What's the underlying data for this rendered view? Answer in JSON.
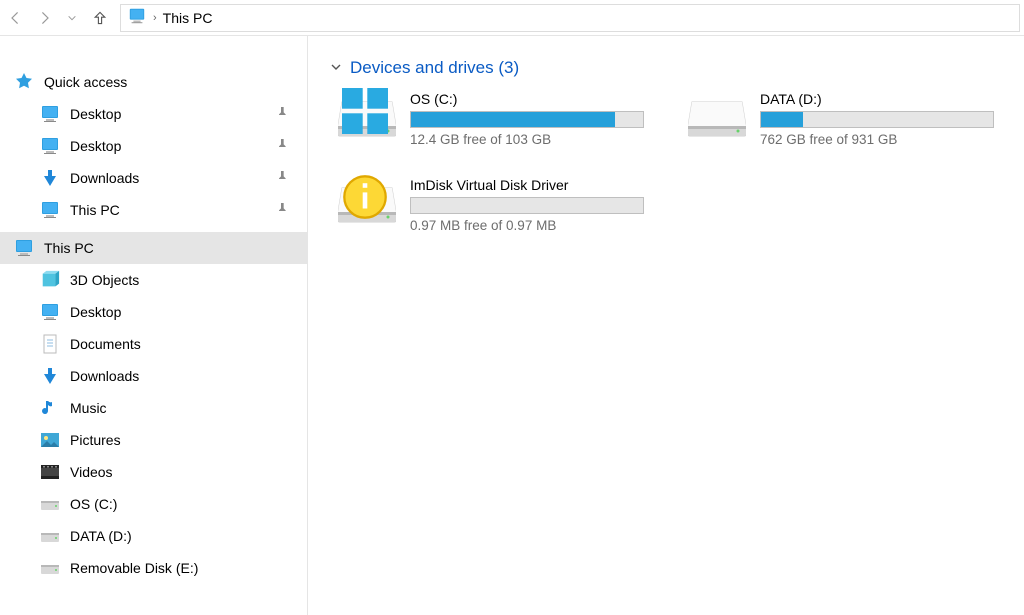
{
  "breadcrumb": {
    "location": "This PC"
  },
  "sidebar": {
    "quick_access": {
      "label": "Quick access",
      "items": [
        {
          "label": "Desktop"
        },
        {
          "label": "Desktop"
        },
        {
          "label": "Downloads"
        },
        {
          "label": "This PC"
        }
      ]
    },
    "this_pc": {
      "label": "This PC",
      "items": [
        {
          "label": "3D Objects"
        },
        {
          "label": "Desktop"
        },
        {
          "label": "Documents"
        },
        {
          "label": "Downloads"
        },
        {
          "label": "Music"
        },
        {
          "label": "Pictures"
        },
        {
          "label": "Videos"
        },
        {
          "label": "OS (C:)"
        },
        {
          "label": "DATA (D:)"
        },
        {
          "label": "Removable Disk (E:)"
        }
      ]
    }
  },
  "main": {
    "group_header": "Devices and drives (3)",
    "drives": [
      {
        "name": "OS (C:)",
        "free_text": "12.4 GB free of 103 GB",
        "fill_pct": 88
      },
      {
        "name": "DATA (D:)",
        "free_text": "762 GB free of 931 GB",
        "fill_pct": 18
      },
      {
        "name": "ImDisk Virtual Disk Driver",
        "free_text": "0.97 MB free of 0.97 MB",
        "fill_pct": 0
      }
    ]
  }
}
